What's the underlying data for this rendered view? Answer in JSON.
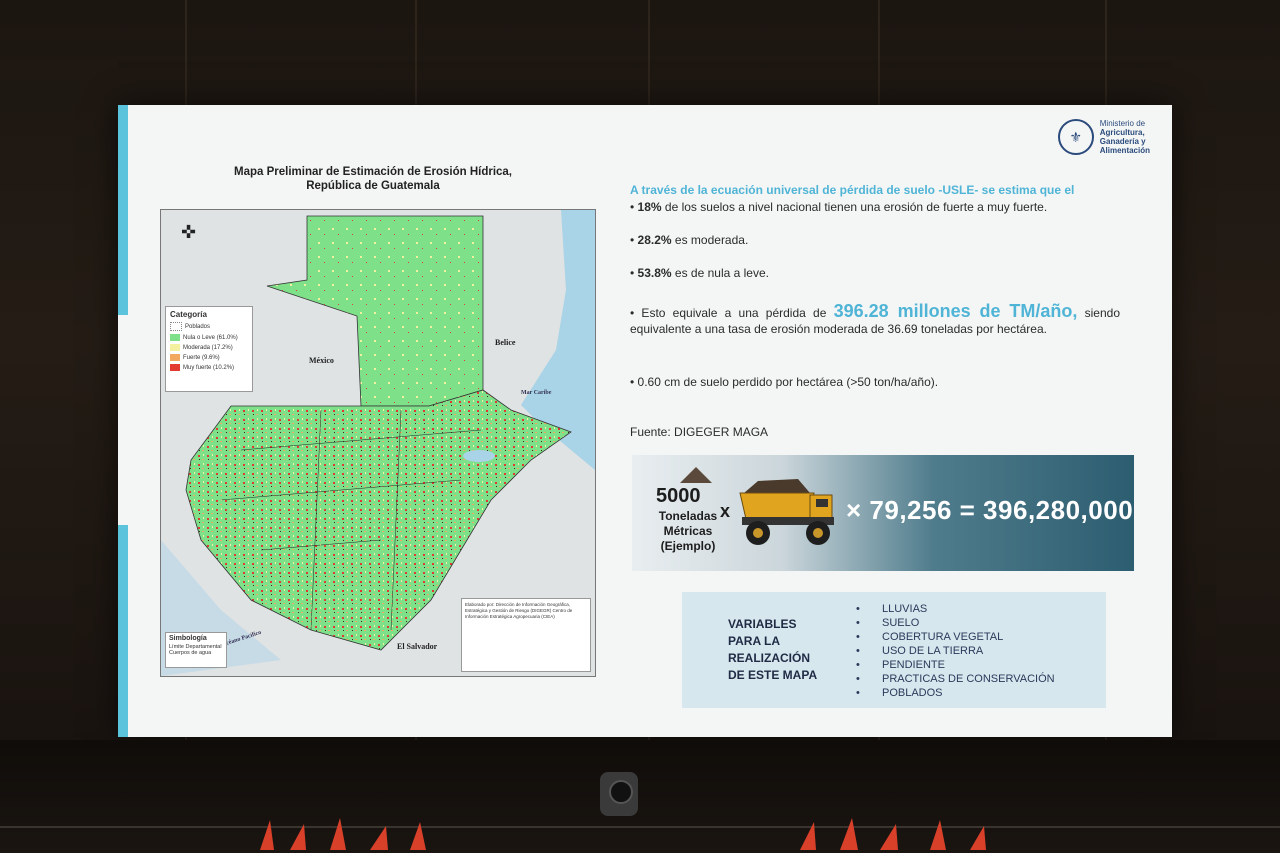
{
  "ministry": {
    "line1": "Ministerio de",
    "line2": "Agricultura,",
    "line3": "Ganadería y",
    "line4": "Alimentación"
  },
  "map": {
    "title_line1": "Mapa Preliminar de Estimación de Erosión Hídrica,",
    "title_line2": "República de Guatemala",
    "legend_title": "Categoría",
    "legend_items": [
      "Poblados",
      "Nula o Leve (61.0%)",
      "Moderada (17.2%)",
      "Fuerte (9.6%)",
      "Muy fuerte (10.2%)"
    ],
    "legend_colors": [
      "#ffffff",
      "#7fe08a",
      "#f3f0a0",
      "#f3a860",
      "#e23a30"
    ],
    "simbologia_title": "Simbología",
    "simbologia_items": [
      "Límite Departamental",
      "Cuerpos de agua"
    ],
    "places": {
      "mexico": "México",
      "belice": "Belice",
      "el_salvador": "El Salvador",
      "mar_caribe": "Mar Caribe",
      "oceano": "Océano Pacífico"
    },
    "credits": "Elaborado por: Dirección de Información Geográfica, Estratégica y Gestión de Riesgo (DIGEGR) Centro de Información Estratégica Agropecuaria (CIEA)"
  },
  "content": {
    "intro": "A través de la ecuación universal de pérdida de suelo -USLE- se estima que el",
    "b1_bold": "18%",
    "b1_rest": " de los suelos a nivel nacional tienen una erosión de fuerte a muy fuerte.",
    "b2_bold": "28.2%",
    "b2_rest": " es moderada.",
    "b3_bold": "53.8%",
    "b3_rest": " es de nula a leve.",
    "b4_pre": "• Esto equivale a una pérdida de ",
    "b4_big": "396.28 millones de TM/año,",
    "b4_post": " siendo equivalente a una tasa de erosión moderada de 36.69 toneladas por hectárea.",
    "b5": "• 0.60 cm de suelo perdido por hectárea (>50 ton/ha/año).",
    "fuente": "Fuente: DIGEGER MAGA"
  },
  "banner": {
    "tons": "5000",
    "tons_label_1": "Toneladas",
    "tons_label_2": "Métricas",
    "tons_label_3": "(Ejemplo)",
    "times1": "x",
    "equation": "× 79,256 = 396,280,000"
  },
  "variables": {
    "title_1": "VARIABLES",
    "title_2": "PARA LA",
    "title_3": "REALIZACIÓN",
    "title_4": "DE ESTE MAPA",
    "items": [
      "LLUVIAS",
      "SUELO",
      "COBERTURA VEGETAL",
      "USO DE LA TIERRA",
      "PENDIENTE",
      "PRACTICAS DE CONSERVACIÓN",
      "POBLADOS"
    ]
  }
}
